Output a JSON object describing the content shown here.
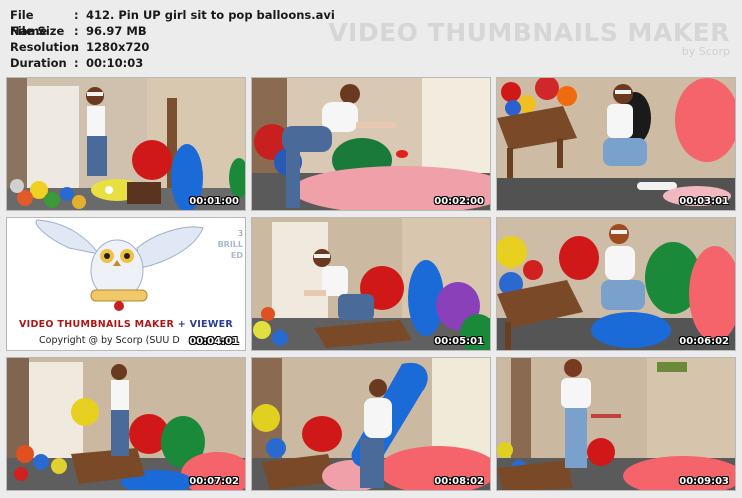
{
  "info": {
    "rows": [
      {
        "key": "File Name",
        "value": "412. Pin UP girl sit to pop balloons.avi"
      },
      {
        "key": "File Size",
        "value": "96.97 MB"
      },
      {
        "key": "Resolution",
        "value": "1280x720"
      },
      {
        "key": "Duration",
        "value": "00:10:03"
      }
    ],
    "separator": ":"
  },
  "watermark": {
    "title": "VIDEO THUMBNAILS MAKER",
    "byline": "by Scorp"
  },
  "logo": {
    "title_a": "VIDEO THUMBNAILS MAKER",
    "plus": "+",
    "title_b": "VIEWER",
    "copyright": "Copyright @ by Scorp (SUU D",
    "side_num": "3",
    "side_a": "BRILL",
    "side_b": "ED"
  },
  "thumbnails": [
    {
      "time": "00:01:00",
      "scene": "girl-sitting-on-yellow-balloon"
    },
    {
      "time": "00:02:00",
      "scene": "girl-leaning-on-pink-balloon"
    },
    {
      "time": "00:03:01",
      "scene": "girl-sitting-between-balloons"
    },
    {
      "time": "00:04:01",
      "scene": "logo"
    },
    {
      "time": "00:05:01",
      "scene": "girl-kneeling-at-table"
    },
    {
      "time": "00:06:02",
      "scene": "girl-sitting-on-blue-balloon"
    },
    {
      "time": "00:07:02",
      "scene": "girl-standing-in-room"
    },
    {
      "time": "00:08:02",
      "scene": "girl-hugging-blue-balloon"
    },
    {
      "time": "00:09:03",
      "scene": "girl-standing-with-pink-balloon"
    }
  ],
  "colors": {
    "background": "#ececec",
    "logo_red": "#b01515",
    "logo_blue": "#2a3a9a"
  }
}
